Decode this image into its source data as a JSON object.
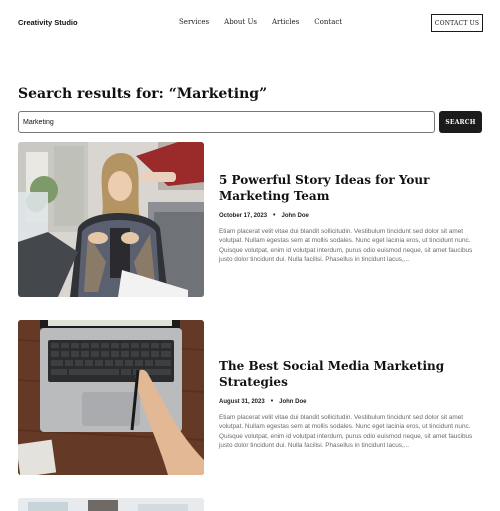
{
  "header": {
    "logo": "Creativity Studio",
    "nav": [
      "Services",
      "About Us",
      "Articles",
      "Contact"
    ],
    "contact_button": "CONTACT US"
  },
  "search": {
    "title": "Search results for: “Marketing”",
    "value": "Marketing",
    "button": "SEARCH"
  },
  "articles": [
    {
      "title": "5 Powerful Story Ideas for Your Marketing Team",
      "date": "October 17, 2023",
      "author": "John Doe",
      "excerpt": "Etiam placerat velit vitae dui blandit sollicitudin. Vestibulum tincidunt sed dolor sit amet volutpat. Nullam egestas sem at mollis sodales. Nunc eget lacinia eros, ut tincidunt nunc. Quisque volutpat, enim id volutpat interdum, purus odio euismod neque, sit amet faucibus justo dolor tincidunt dui. Nulla facilisi. Phasellus in tincidunt lacus,..."
    },
    {
      "title": "The Best Social Media Marketing Strategies",
      "date": "August 31, 2023",
      "author": "John Doe",
      "excerpt": "Etiam placerat velit vitae dui blandit sollicitudin. Vestibulum tincidunt sed dolor sit amet volutpat. Nullam egestas sem at mollis sodales. Nunc eget lacinia eros, ut tincidunt nunc. Quisque volutpat, enim id volutpat interdum, purus odio euismod neque, sit amet faucibus justo dolor tincidunt dui. Nulla facilisi. Phasellus in tincidunt lacus,..."
    }
  ],
  "colors": {
    "text": "#111111",
    "muted": "#6a6a6a",
    "button_dark": "#1b1b1b"
  }
}
